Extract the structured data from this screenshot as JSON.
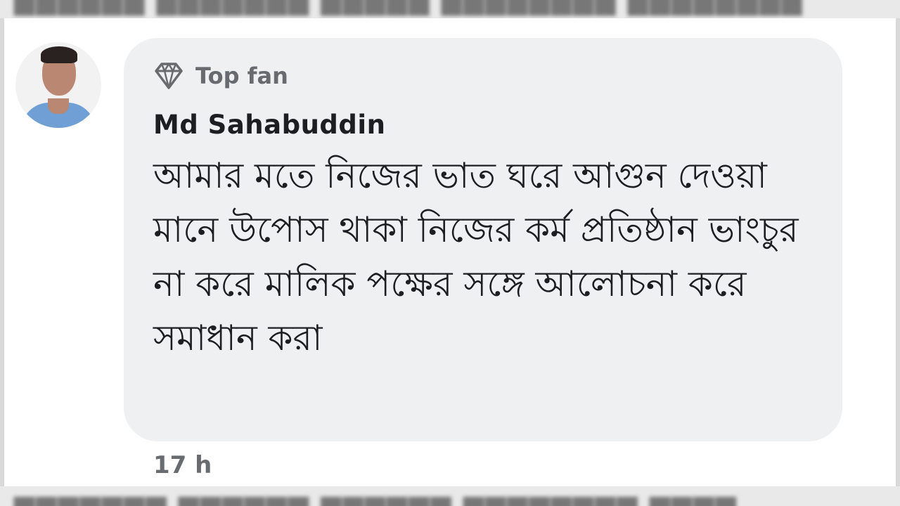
{
  "comment": {
    "badge_label": "Top fan",
    "badge_icon": "diamond-icon",
    "author_name": "Md Sahabuddin",
    "text": "আমার মতে নিজের ভাত ঘরে আগুন দেওয়া মানে উপোস থাকা নিজের কর্ম প্রতিষ্ঠান ভাংচুর না করে মালিক পক্ষের সঙ্গে আলোচনা করে সমাধান করা",
    "timestamp": "17 h"
  },
  "colors": {
    "bubble_bg": "#eff0f2",
    "name_text": "#1c1e21",
    "meta_text": "#676b70"
  }
}
